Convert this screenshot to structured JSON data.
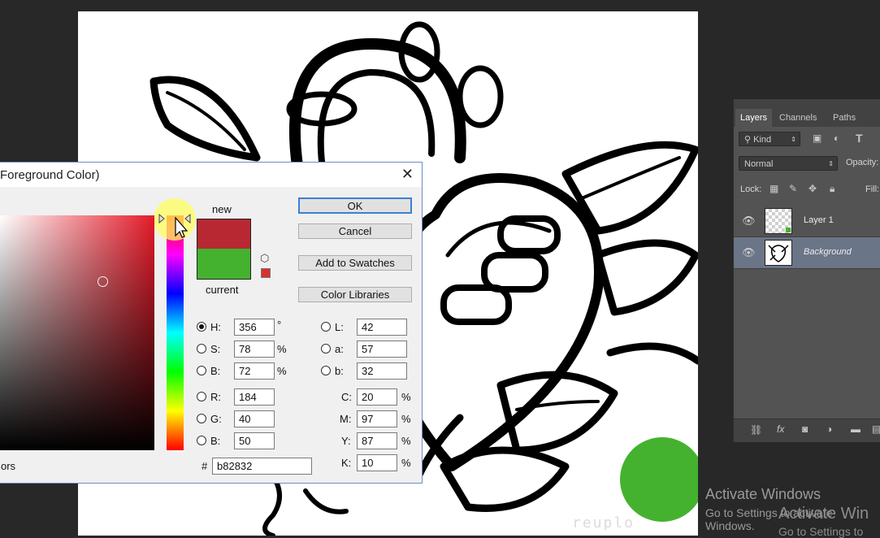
{
  "dialog": {
    "title": "Foreground Color)",
    "buttons": {
      "ok": "OK",
      "cancel": "Cancel",
      "add_to_swatches": "Add to Swatches",
      "color_libraries": "Color Libraries"
    },
    "labels": {
      "new": "new",
      "current": "current"
    },
    "new_color": "#b82832",
    "current_color": "#44b22f",
    "hsb": {
      "h_label": "H:",
      "h": "356",
      "h_unit": "°",
      "s_label": "S:",
      "s": "78",
      "s_unit": "%",
      "b_label": "B:",
      "b": "72",
      "b_unit": "%"
    },
    "rgb": {
      "r_label": "R:",
      "r": "184",
      "g_label": "G:",
      "g": "40",
      "b_label": "B:",
      "b": "50"
    },
    "lab": {
      "l_label": "L:",
      "l": "42",
      "a_label": "a:",
      "a": "57",
      "b_label": "b:",
      "b": "32"
    },
    "cmyk": {
      "c_label": "C:",
      "c": "20",
      "m_label": "M:",
      "m": "97",
      "y_label": "Y:",
      "y": "87",
      "k_label": "K:",
      "k": "10",
      "unit": "%"
    },
    "hex_label": "#",
    "hex": "b82832",
    "only_web_colors_partial": "ors"
  },
  "layers_panel": {
    "tabs": [
      "Layers",
      "Channels",
      "Paths"
    ],
    "filter_kind": "Kind",
    "blend_mode": "Normal",
    "opacity_label": "Opacity:",
    "lock_label": "Lock:",
    "fill_label": "Fill:",
    "layers": [
      {
        "name": "Layer 1",
        "selected": false
      },
      {
        "name": "Background",
        "selected": true
      }
    ]
  },
  "watermark": "reuplo",
  "activate_windows": {
    "title": "Activate Windows",
    "subtitle": "Go to Settings to activate Windows.",
    "title_dup": "Activate Win",
    "subtitle_dup": "Go to Settings to"
  }
}
